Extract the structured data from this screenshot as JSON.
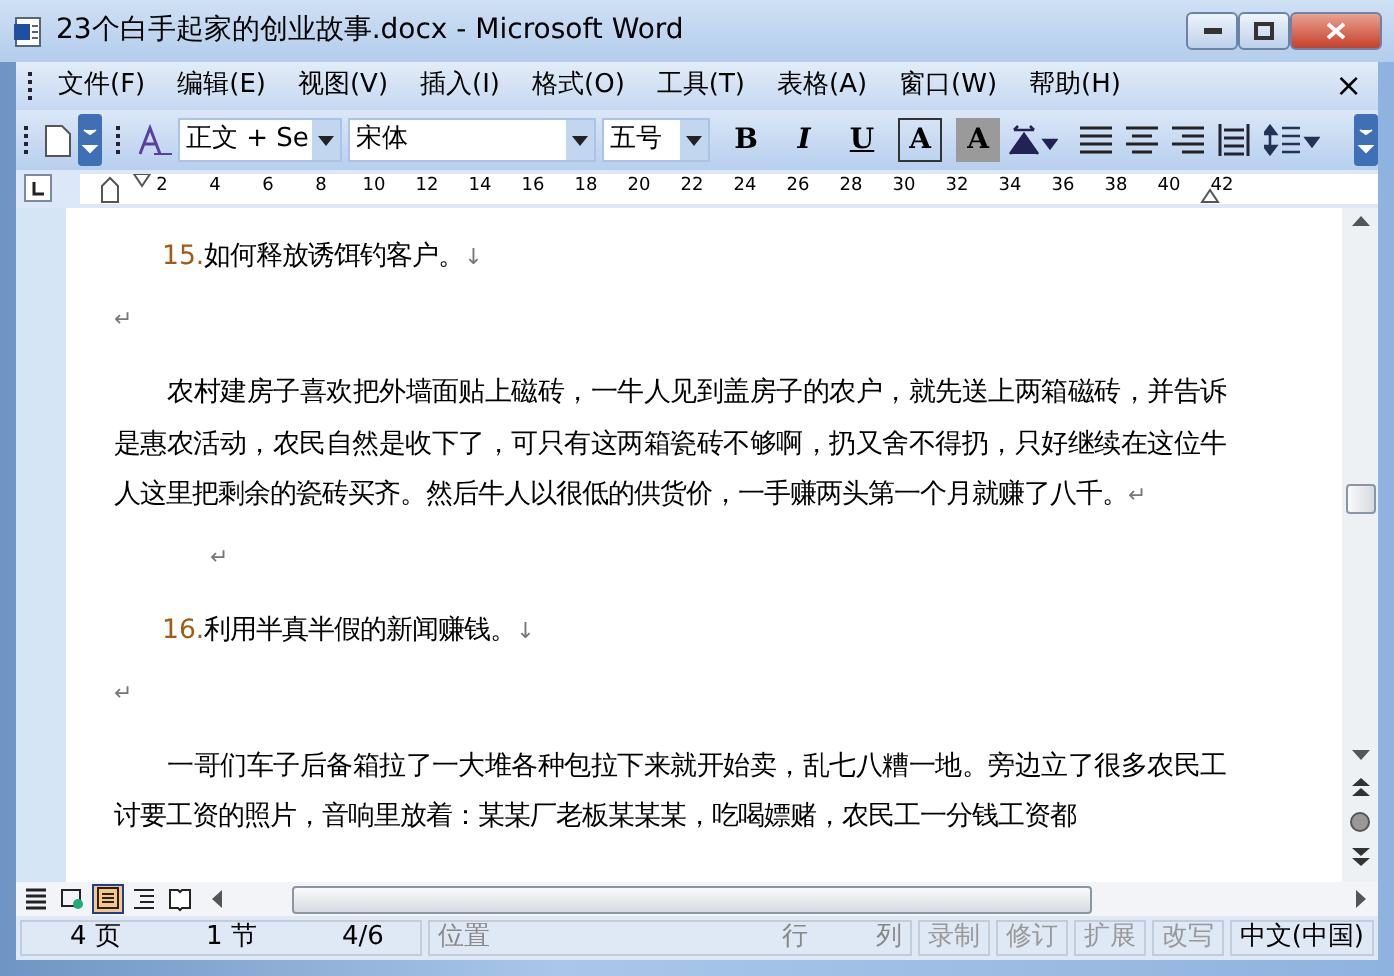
{
  "window": {
    "title": "23个白手起家的创业故事.docx - Microsoft Word"
  },
  "menu": {
    "items": [
      "文件(F)",
      "编辑(E)",
      "视图(V)",
      "插入(I)",
      "格式(O)",
      "工具(T)",
      "表格(A)",
      "窗口(W)",
      "帮助(H)"
    ],
    "close": "×"
  },
  "toolbar": {
    "style": "正文 + Se",
    "font": "宋体",
    "size": "五号",
    "buttons": [
      {
        "kind": "bold",
        "label": "B"
      },
      {
        "kind": "italic",
        "label": "I"
      },
      {
        "kind": "underline",
        "label": "U"
      },
      {
        "kind": "border",
        "label": "A"
      },
      {
        "kind": "shade",
        "label": "A"
      }
    ]
  },
  "ruler": {
    "numbers": [
      "2",
      "4",
      "6",
      "8",
      "10",
      "12",
      "14",
      "16",
      "18",
      "20",
      "22",
      "24",
      "26",
      "28",
      "30",
      "32",
      "34",
      "36",
      "38",
      "40",
      "42"
    ]
  },
  "document": [
    {
      "kind": "heading",
      "number": "15.",
      "text": "如何释放诱饵钓客户。",
      "mark": "↓"
    },
    {
      "kind": "empty",
      "mark": "↵"
    },
    {
      "kind": "paragraph",
      "text": "农村建房子喜欢把外墙面贴上磁砖，一牛人见到盖房子的农户，就先送上两箱磁砖，并告诉是惠农活动，农民自然是收下了，可只有这两箱瓷砖不够啊，扔又舍不得扔，只好继续在这位牛人这里把剩余的瓷砖买齐。然后牛人以很低的供货价，一手赚两头第一个月就赚了八千。",
      "mark": "↵"
    },
    {
      "kind": "empty_indented",
      "mark": "↵"
    },
    {
      "kind": "heading",
      "number": "16.",
      "text": "利用半真半假的新闻赚钱。",
      "mark": "↓"
    },
    {
      "kind": "empty",
      "mark": "↵"
    },
    {
      "kind": "paragraph",
      "text": "一哥们车子后备箱拉了一大堆各种包拉下来就开始卖，乱七八糟一地。旁边立了很多农民工讨要工资的照片，音响里放着：某某厂老板某某某，吃喝嫖赌，农民工一分钱工资都"
    }
  ],
  "view_buttons": [
    {
      "selected": false
    },
    {
      "selected": false
    },
    {
      "selected": true
    },
    {
      "selected": false
    },
    {
      "selected": false
    }
  ],
  "status_bar": [
    {
      "kind": "info",
      "text": "4 页"
    },
    {
      "kind": "info",
      "text": "1 节"
    },
    {
      "kind": "info",
      "text": "4/6"
    },
    {
      "kind": "label",
      "text": "位置"
    },
    {
      "kind": "label",
      "text": "行"
    },
    {
      "kind": "label",
      "text": "列"
    },
    {
      "kind": "mode",
      "text": "录制",
      "disabled": true
    },
    {
      "kind": "mode",
      "text": "修订",
      "disabled": true
    },
    {
      "kind": "mode",
      "text": "扩展",
      "disabled": true
    },
    {
      "kind": "mode",
      "text": "改写",
      "disabled": true
    },
    {
      "kind": "lang",
      "text": "中文(中国)"
    }
  ]
}
